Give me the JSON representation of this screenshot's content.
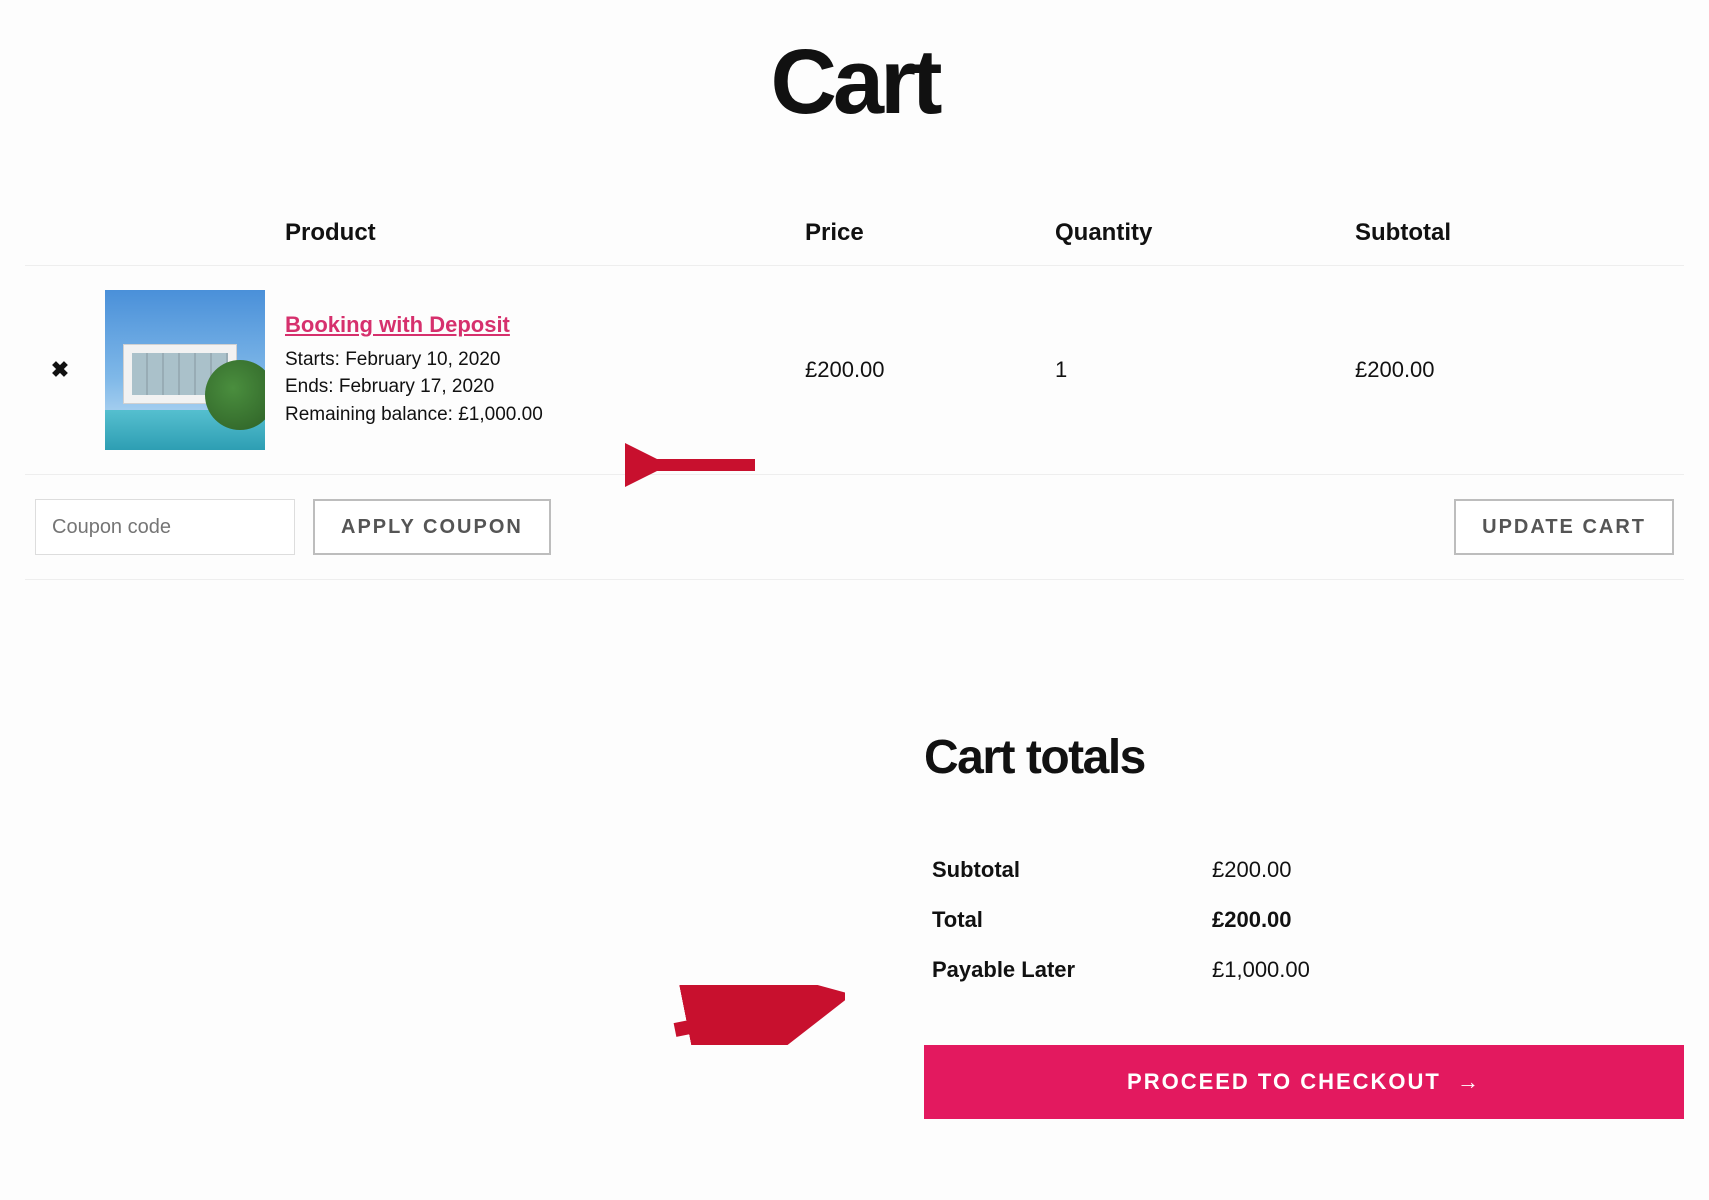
{
  "page": {
    "title": "Cart"
  },
  "headers": {
    "product": "Product",
    "price": "Price",
    "quantity": "Quantity",
    "subtotal": "Subtotal"
  },
  "item": {
    "name": "Booking with Deposit",
    "starts_label": "Starts:",
    "starts_value": "February 10, 2020",
    "ends_label": "Ends:",
    "ends_value": "February 17, 2020",
    "balance_label": "Remaining balance:",
    "balance_value": "£1,000.00",
    "price": "£200.00",
    "quantity": "1",
    "subtotal": "£200.00",
    "remove_glyph": "✖"
  },
  "coupon": {
    "placeholder": "Coupon code",
    "apply_label": "APPLY COUPON"
  },
  "update_label": "UPDATE CART",
  "totals": {
    "title": "Cart totals",
    "subtotal_label": "Subtotal",
    "subtotal_value": "£200.00",
    "total_label": "Total",
    "total_value": "£200.00",
    "later_label": "Payable Later",
    "later_value": "£1,000.00"
  },
  "checkout": {
    "label": "PROCEED TO CHECKOUT",
    "arrow": "→"
  }
}
